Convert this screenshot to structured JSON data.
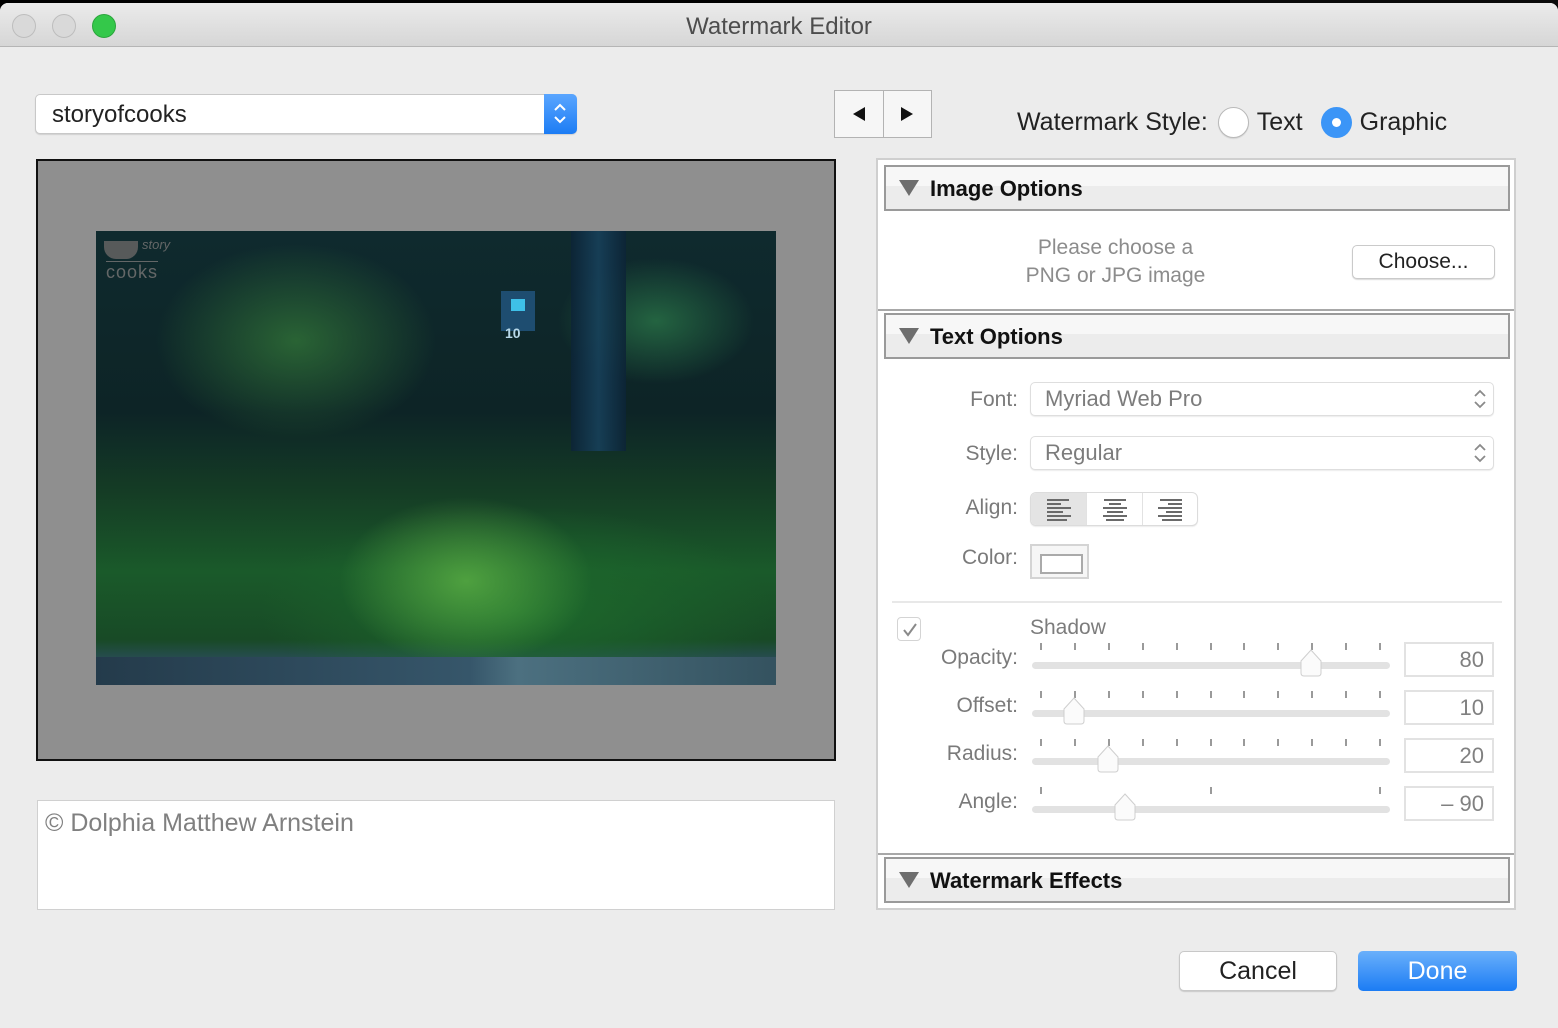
{
  "window": {
    "title": "Watermark Editor"
  },
  "preset": {
    "selected": "storyofcooks"
  },
  "watermark_style": {
    "label": "Watermark Style:",
    "options": [
      {
        "label": "Text",
        "selected": false
      },
      {
        "label": "Graphic",
        "selected": true
      }
    ]
  },
  "preview": {
    "watermark_logo_top": "story",
    "watermark_logo_bottom": "cooks",
    "sign_number": "10"
  },
  "copyright_text": "© Dolphia Matthew Arnstein",
  "image_options": {
    "header": "Image Options",
    "hint_line1": "Please choose a",
    "hint_line2": "PNG or JPG image",
    "choose_button": "Choose..."
  },
  "text_options": {
    "header": "Text Options",
    "font_label": "Font:",
    "font_value": "Myriad Web Pro",
    "style_label": "Style:",
    "style_value": "Regular",
    "align_label": "Align:",
    "align_options": [
      "left",
      "center",
      "right"
    ],
    "align_selected": "left",
    "color_label": "Color:",
    "shadow": {
      "enabled": true,
      "label": "Shadow",
      "sliders": [
        {
          "label": "Opacity:",
          "value": "80",
          "fraction": 0.8,
          "ticks": 11
        },
        {
          "label": "Offset:",
          "value": "10",
          "fraction": 0.1,
          "ticks": 11
        },
        {
          "label": "Radius:",
          "value": "20",
          "fraction": 0.2,
          "ticks": 11
        },
        {
          "label": "Angle:",
          "value": "– 90",
          "fraction": 0.25,
          "ticks": 3
        }
      ]
    }
  },
  "watermark_effects": {
    "header": "Watermark Effects"
  },
  "buttons": {
    "cancel": "Cancel",
    "done": "Done"
  },
  "colors": {
    "accent": "#1c7cf4",
    "traffic_green": "#34c84a"
  }
}
